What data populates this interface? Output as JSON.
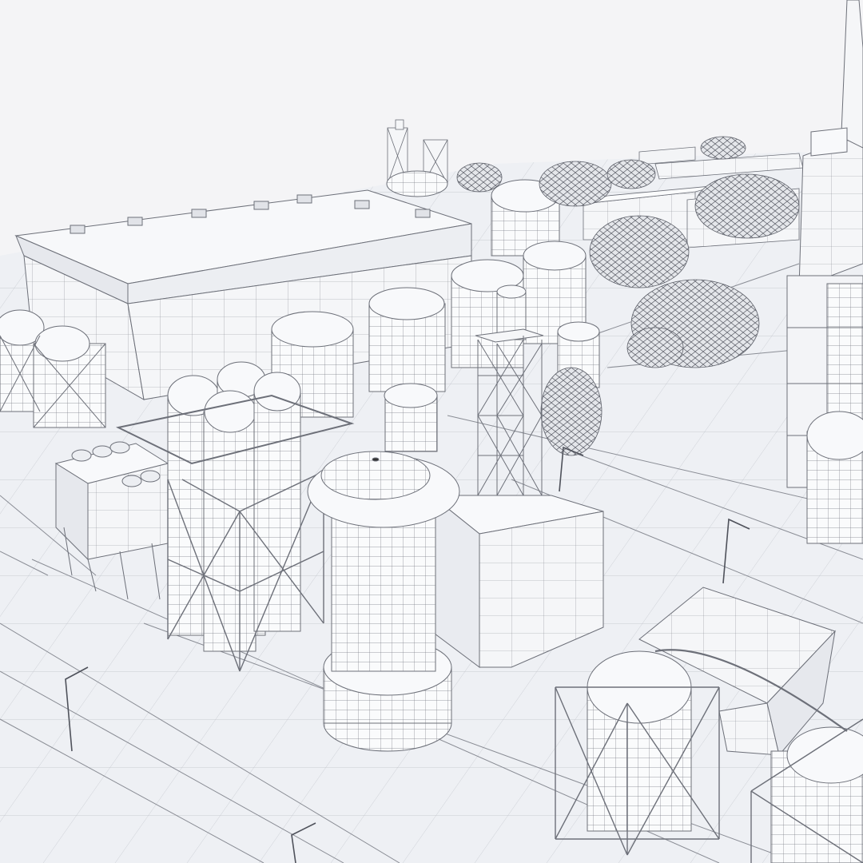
{
  "scene": {
    "kind": "3D wireframe render of an industrial plant",
    "palette": {
      "sky": "#f4f4f6",
      "ground": "#eceef3",
      "surface": "#f8f9fb",
      "shade": "#dcdfe6",
      "line": "#6d7079",
      "tree": "#c9ccd3"
    },
    "objects": [
      "factory-hall",
      "cylindrical-tanks",
      "triple-silo-group",
      "water-tower",
      "lattice-tower",
      "chimney-tower",
      "spherical-tank-frames",
      "warehouse",
      "hvac-units",
      "trees",
      "street-lamps",
      "roads"
    ]
  }
}
